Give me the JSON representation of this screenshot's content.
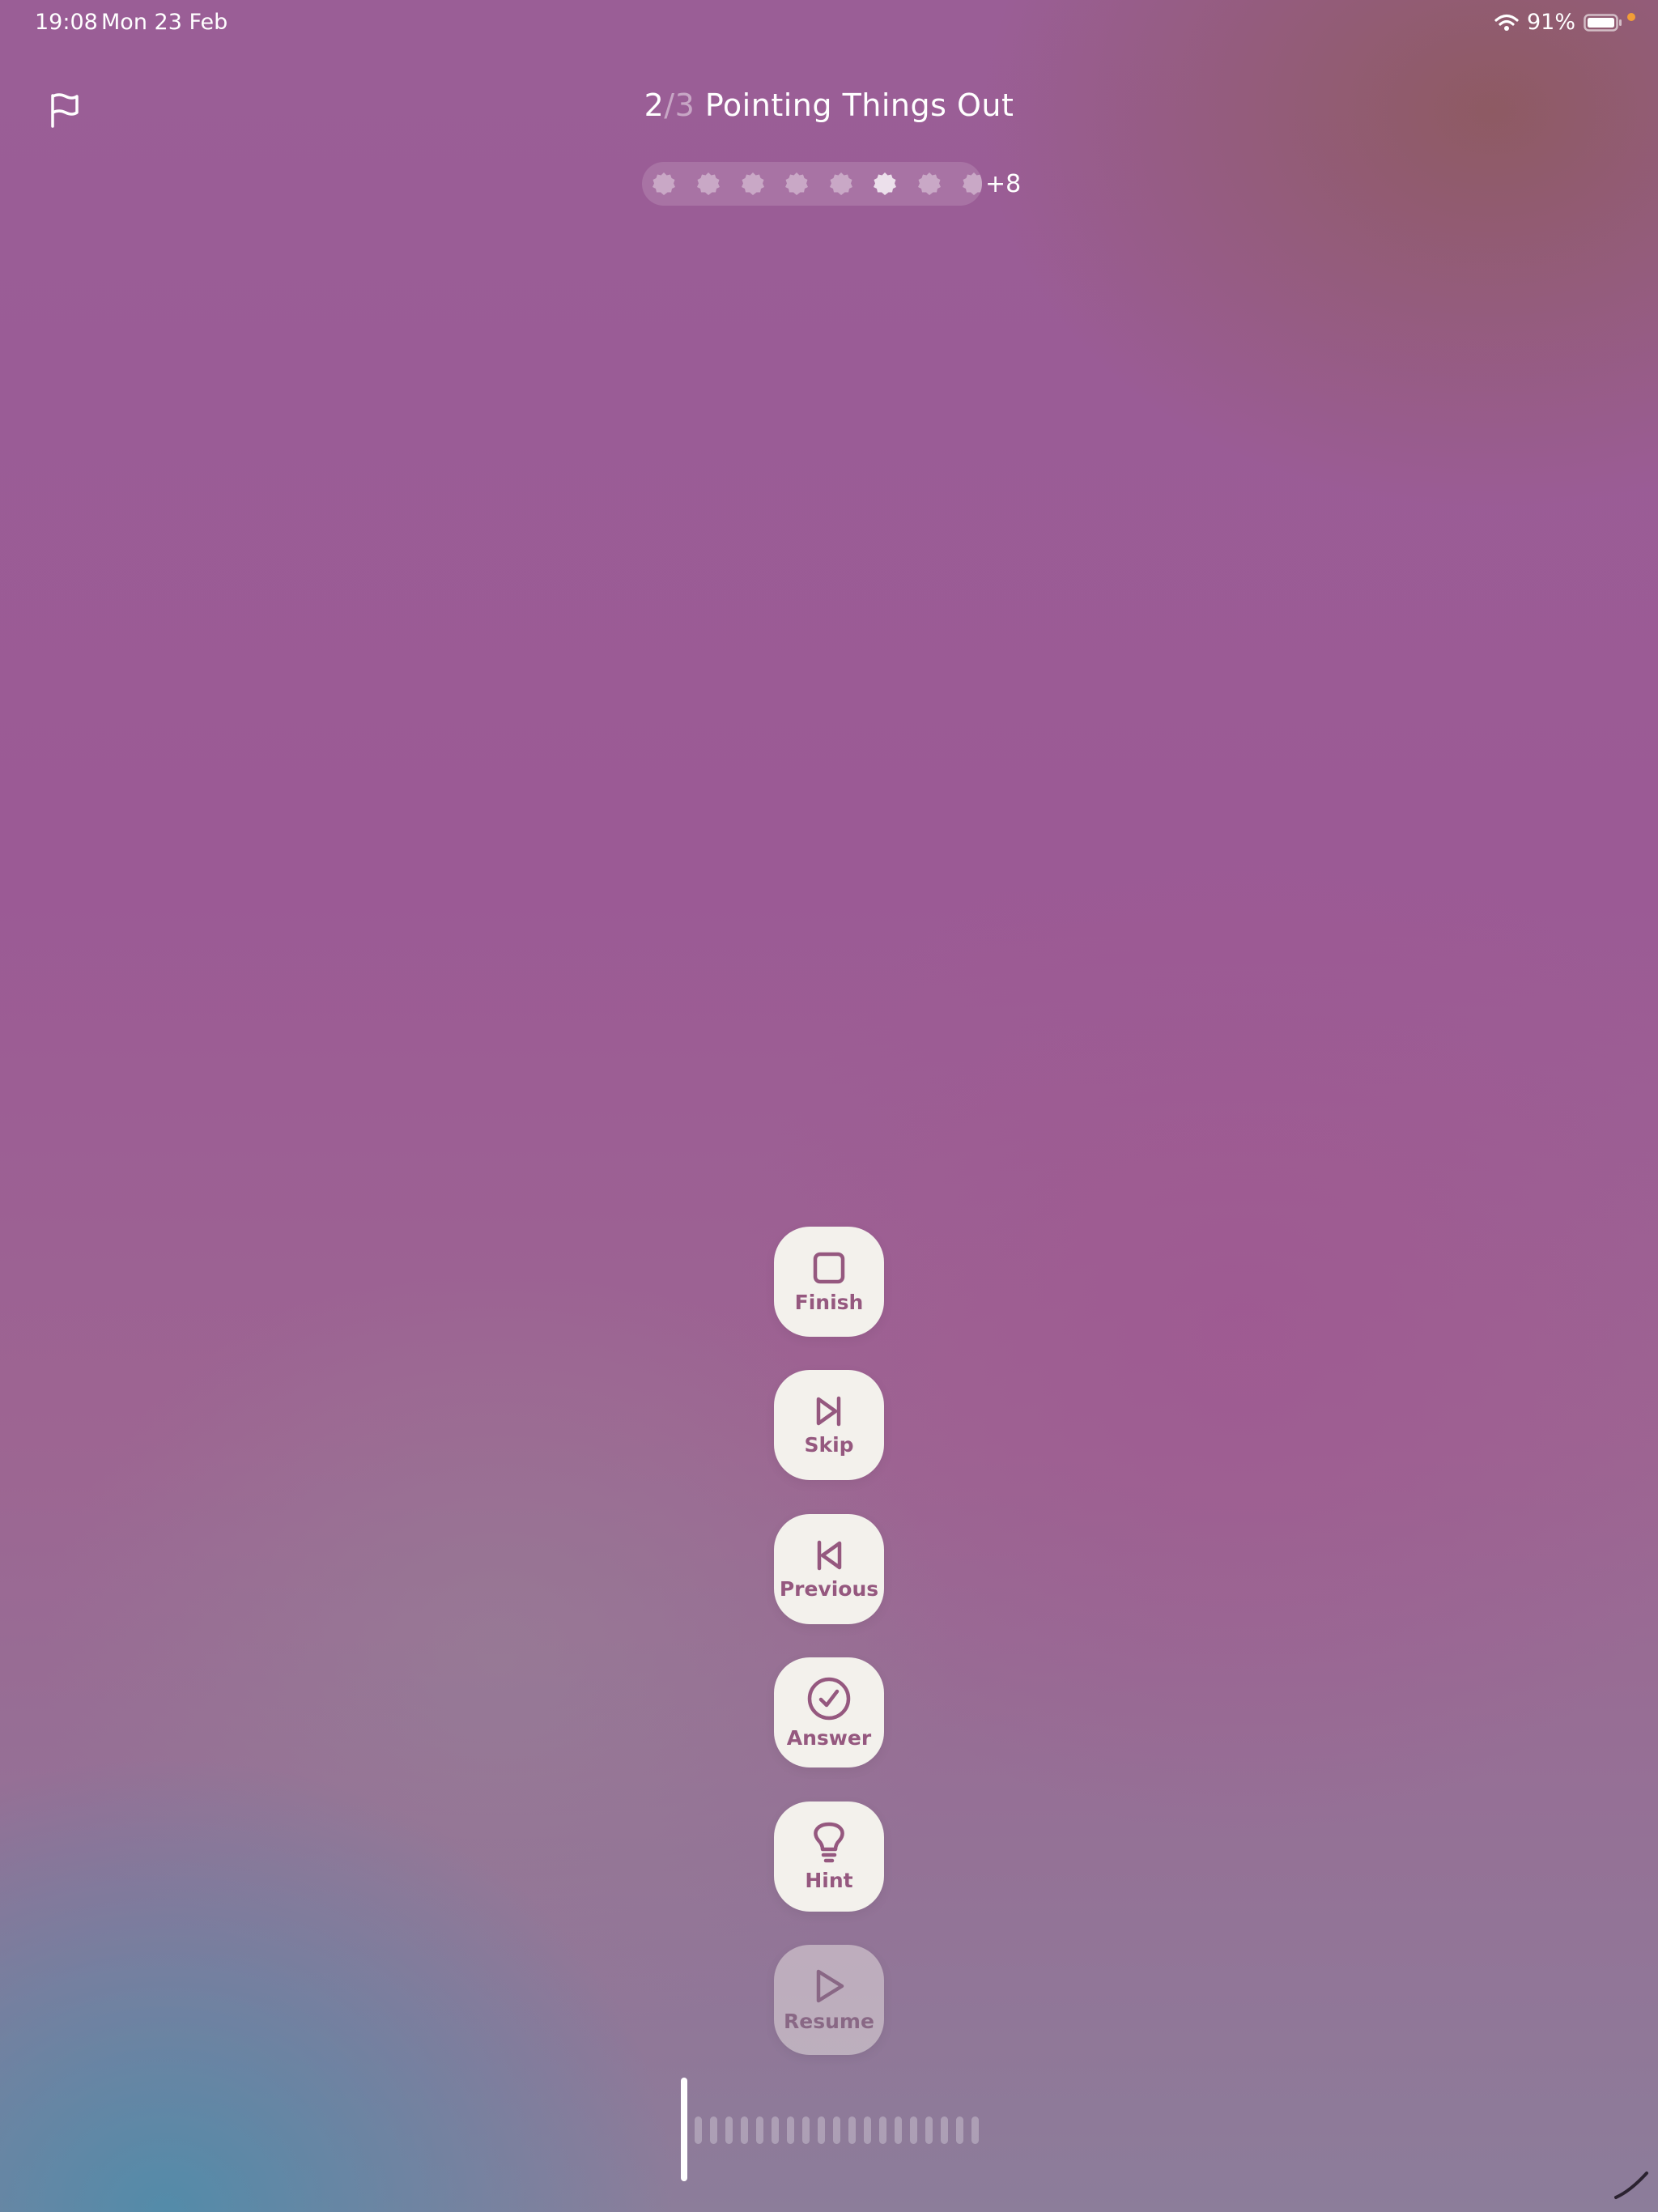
{
  "status_bar": {
    "time": "19:08",
    "date": "Mon 23 Feb",
    "battery": "91%"
  },
  "header": {
    "flag_icon": "flag-icon",
    "progress_current": "2",
    "progress_separator": "/",
    "progress_total": "3",
    "title": "Pointing Things Out"
  },
  "progress": {
    "dot_count_visible": 8,
    "highlighted_dot": 6,
    "extra_label": "+8"
  },
  "actions": {
    "finish": {
      "label": "Finish",
      "icon": "stop-square-icon"
    },
    "skip": {
      "label": "Skip",
      "icon": "skip-forward-icon"
    },
    "previous": {
      "label": "Previous",
      "icon": "skip-back-icon"
    },
    "answer": {
      "label": "Answer",
      "icon": "check-circle-icon"
    },
    "hint": {
      "label": "Hint",
      "icon": "lightbulb-icon"
    },
    "resume": {
      "label": "Resume",
      "icon": "play-icon"
    }
  },
  "colors": {
    "button_bg": "#f3f1ec",
    "button_fg": "#95587f",
    "battery_indicator": "#f29d37"
  }
}
